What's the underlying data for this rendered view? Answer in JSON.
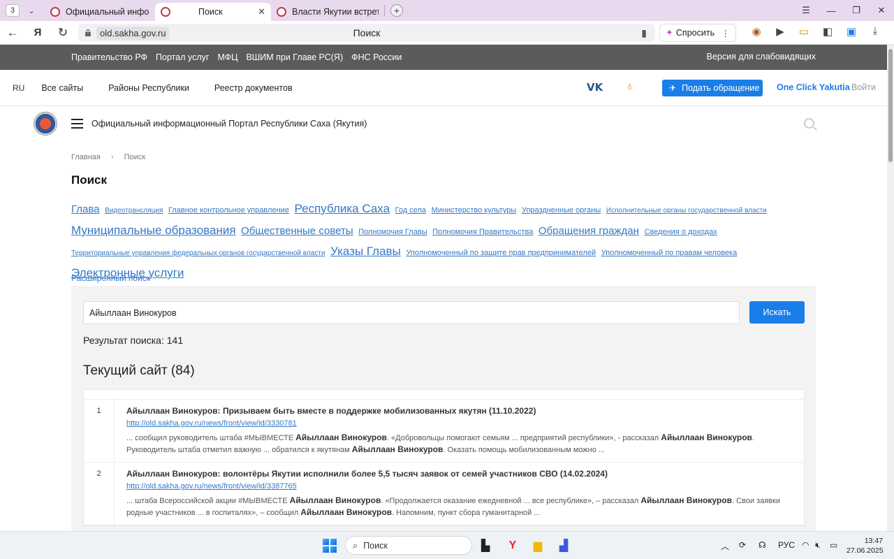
{
  "browser": {
    "tab_count": "3",
    "tabs": [
      {
        "title": "Официальный информа"
      },
      {
        "title": "Поиск"
      },
      {
        "title": "Власти Якутии встретили"
      }
    ],
    "url_host": "old.sakha.gov.ru",
    "page_title": "Поиск",
    "ask_label": "Спросить"
  },
  "gov_bar": {
    "links": [
      "Правительство РФ",
      "Портал услуг",
      "МФЦ",
      "ВШИМ при Главе РС(Я)",
      "ФНС России"
    ],
    "vision": "Версия для слабовидящих"
  },
  "top_nav": {
    "lang": "RU",
    "links": [
      "Все сайты",
      "Районы Республики",
      "Реестр документов"
    ],
    "vk": "VK",
    "appeal": "Подать обращение",
    "one_click": "One Click Yakutia",
    "login": "Войти"
  },
  "portal": {
    "title": "Официальный информационный Портал Республики Саха (Якутия)"
  },
  "breadcrumbs": [
    "Главная",
    "Поиск"
  ],
  "heading": "Поиск",
  "tags": [
    {
      "text": "Глава",
      "size": 4
    },
    {
      "text": "Видеотрансляция",
      "size": 1
    },
    {
      "text": "Главное контрольное управление",
      "size": 2
    },
    {
      "text": "Республика Саха",
      "size": 5
    },
    {
      "text": "Год села",
      "size": 2
    },
    {
      "text": "Министерство культуры",
      "size": 2
    },
    {
      "text": "Упраздненные органы",
      "size": 2
    },
    {
      "text": "Исполнительные органы государственной власти",
      "size": 1
    },
    {
      "text": "Муниципальные образования",
      "size": 5
    },
    {
      "text": "Общественные советы",
      "size": 4
    },
    {
      "text": "Полномочия Главы",
      "size": 2
    },
    {
      "text": "Полномочия Правительства",
      "size": 2
    },
    {
      "text": "Обращения граждан",
      "size": 4
    },
    {
      "text": "Сведения о доходах",
      "size": 2
    },
    {
      "text": "Территориальные управления федеральных органов государственной власти",
      "size": 1
    },
    {
      "text": "Указы Главы",
      "size": 5
    },
    {
      "text": "Уполномоченный по защите прав предпринимателей",
      "size": 2
    },
    {
      "text": "Уполномоченный по правам человека",
      "size": 2
    },
    {
      "text": "Электронные услуги",
      "size": 5
    }
  ],
  "advanced_search": "Расширенный поиск",
  "search": {
    "query": "Айыллаан Винокуров",
    "button": "Искать",
    "result_text": "Результат поиска: 141",
    "site_heading": "Текущий сайт (84)"
  },
  "results": [
    {
      "num": "1",
      "title": "Айыллаан Винокуров: Призываем быть вместе в поддержке мобилизованных якутян (11.10.2022)",
      "url": "http://old.sakha.gov.ru/news/front/view/id/3330781",
      "snippet": [
        {
          "t": "... сообщил руководитель штаба #МЫВМЕСТЕ "
        },
        {
          "t": "Айыллаан Винокуров",
          "b": true
        },
        {
          "t": ". «Добровольцы помогают семьям ... предприятий республики», - рассказал "
        },
        {
          "t": "Айыллаан Винокуров",
          "b": true
        },
        {
          "t": ". Руководитель штаба отметил важную ... обратился к якутянам "
        },
        {
          "t": "Айыллаан Винокуров",
          "b": true
        },
        {
          "t": ". Оказать помощь мобилизованным можно ..."
        }
      ]
    },
    {
      "num": "2",
      "title": "Айыллаан Винокуров: волонтёры Якутии исполнили более 5,5 тысяч заявок от семей участников СВО (14.02.2024)",
      "url": "http://old.sakha.gov.ru/news/front/view/id/3387765",
      "snippet": [
        {
          "t": "... штаба Всероссийской акции #МЫВМЕСТЕ "
        },
        {
          "t": "Айыллаан Винокуров",
          "b": true
        },
        {
          "t": ". «Продолжается оказание ежедневной ... все республике», – рассказал "
        },
        {
          "t": "Айыллаан Винокуров",
          "b": true
        },
        {
          "t": ". Свои заявки родные участников ... в госпиталях», – сообщил "
        },
        {
          "t": "Айыллаан Винокуров",
          "b": true
        },
        {
          "t": ". Напомним, пункт сбора гуманитарной ..."
        }
      ]
    }
  ],
  "taskbar": {
    "search": "Поиск",
    "lang": "РУС",
    "time": "13:47",
    "date": "27.06.2025"
  },
  "colors": {
    "accent": "#1a7ee8",
    "link": "#3478c6",
    "gov_bar": "#5b5b5b",
    "tab_strip": "#e9d9ef"
  }
}
